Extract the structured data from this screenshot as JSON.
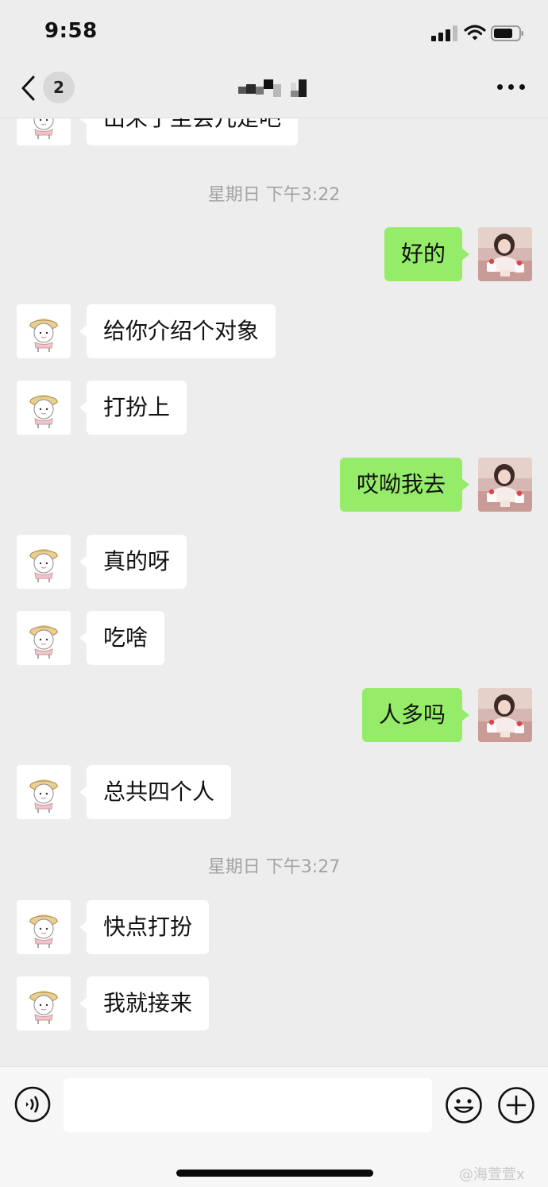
{
  "status_bar": {
    "time": "9:58"
  },
  "nav": {
    "unread_count": "2",
    "title": ""
  },
  "chat": {
    "cut_off_message": "出来了坐会儿是吧",
    "timestamps": [
      "星期日 下午3:22",
      "星期日 下午3:27"
    ],
    "messages": [
      {
        "from": "me",
        "text": "好的"
      },
      {
        "from": "them",
        "text": "给你介绍个对象"
      },
      {
        "from": "them",
        "text": "打扮上"
      },
      {
        "from": "me",
        "text": "哎呦我去"
      },
      {
        "from": "them",
        "text": "真的呀"
      },
      {
        "from": "them",
        "text": "吃啥"
      },
      {
        "from": "me",
        "text": "人多吗"
      },
      {
        "from": "them",
        "text": "总共四个人"
      },
      {
        "from": "them",
        "text": "快点打扮"
      },
      {
        "from": "them",
        "text": "我就接来"
      }
    ]
  },
  "input": {
    "value": "",
    "placeholder": ""
  },
  "watermark": "@海萱萱x",
  "icons": {
    "back": "chevron-left-icon",
    "more": "more-dots-icon",
    "voice": "voice-icon",
    "emoji": "emoji-icon",
    "plus": "plus-icon"
  },
  "colors": {
    "background": "#ededed",
    "my_bubble": "#95ec69",
    "their_bubble": "#ffffff",
    "timestamp": "#a3a3a3"
  }
}
